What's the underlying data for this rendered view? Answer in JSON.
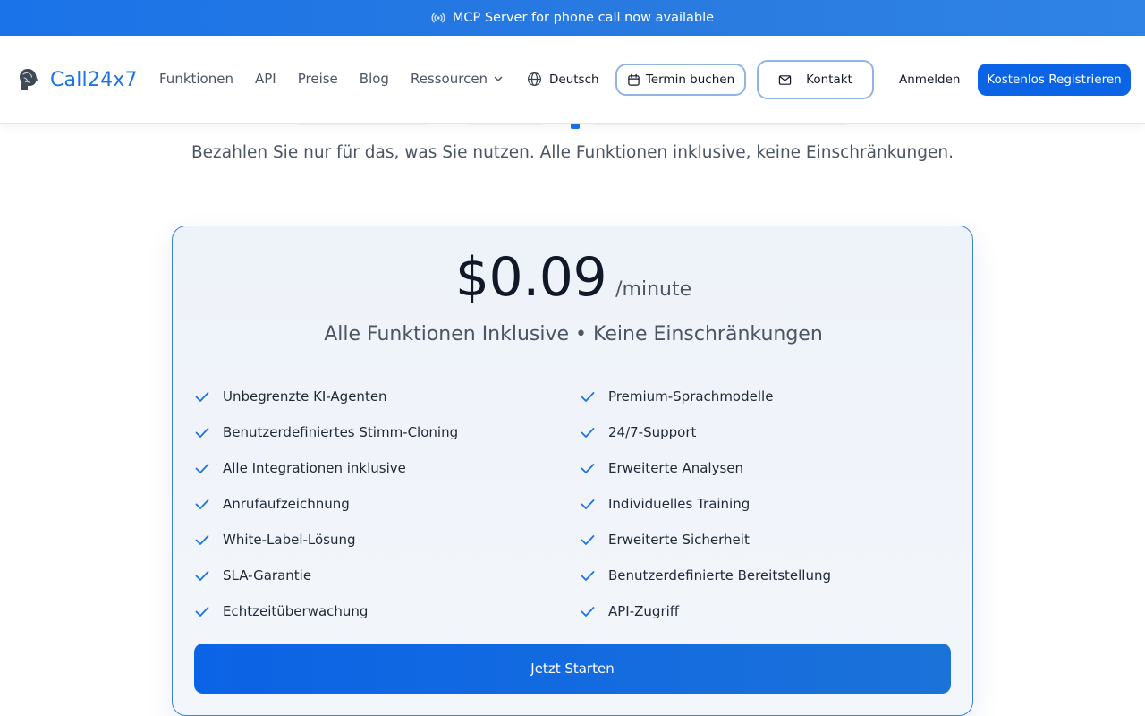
{
  "announcement": {
    "icon": "broadcast-icon",
    "text": "MCP Server for phone call now available"
  },
  "brand": {
    "logo_icon": "brain-icon",
    "name": "Call24x7",
    "accent": "#1a73e8"
  },
  "nav": {
    "items": [
      {
        "label": "Funktionen"
      },
      {
        "label": "API"
      },
      {
        "label": "Preise"
      },
      {
        "label": "Blog"
      },
      {
        "label": "Ressourcen",
        "icon": "chevron-down-icon"
      }
    ]
  },
  "header_actions": {
    "language": {
      "icon": "globe-icon",
      "label": "Deutsch"
    },
    "termin": {
      "icon": "calendar-icon",
      "label": "Termin buchen"
    },
    "kontakt": {
      "icon": "mail-icon",
      "label": "Kontakt"
    },
    "login": "Anmelden",
    "register": "Kostenlos Registrieren"
  },
  "hero": {
    "subtitle": "Bezahlen Sie nur für das, was Sie nutzen. Alle Funktionen inklusive, keine Einschränkungen."
  },
  "pricing": {
    "price": "$0.09",
    "unit": "/minute",
    "tagline": "Alle Funktionen Inklusive • Keine Einschränkungen",
    "check_icon": "check-icon",
    "features": [
      "Unbegrenzte KI-Agenten",
      "Premium-Sprachmodelle",
      "Benutzerdefiniertes Stimm-Cloning",
      "24/7-Support",
      "Alle Integrationen inklusive",
      "Erweiterte Analysen",
      "Anrufaufzeichnung",
      "Individuelles Training",
      "White-Label-Lösung",
      "Erweiterte Sicherheit",
      "SLA-Garantie",
      "Benutzerdefinierte Bereitstellung",
      "Echtzeitüberwachung",
      "API-Zugriff"
    ],
    "cta": "Jetzt Starten"
  },
  "colors": {
    "primary": "#0b63e6",
    "card_border": "#3b82d6",
    "check": "#1a73e8"
  }
}
